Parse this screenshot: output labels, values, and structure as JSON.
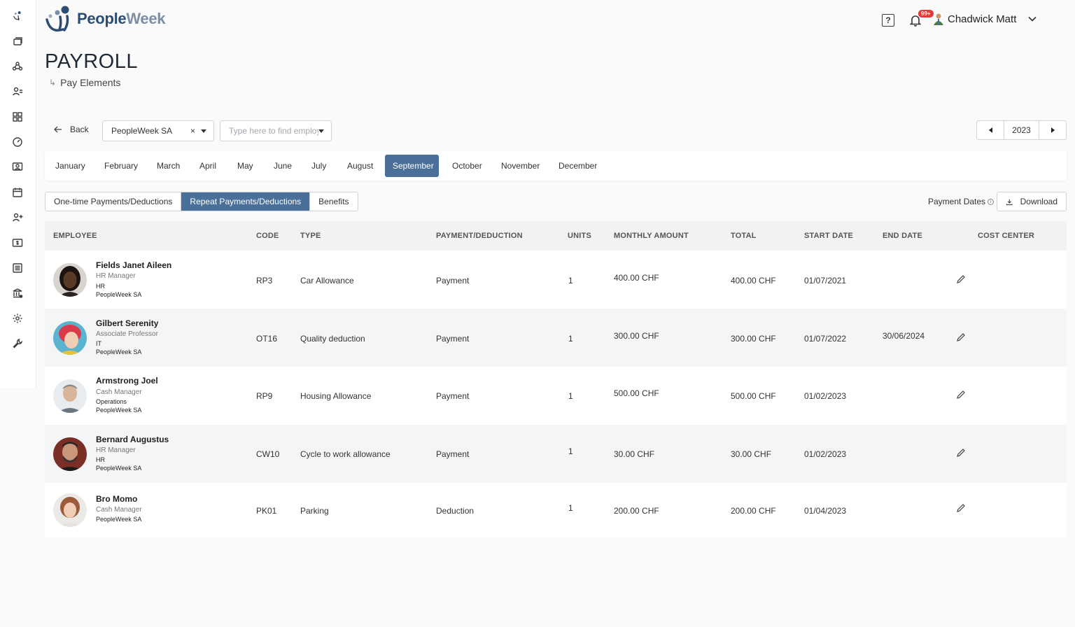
{
  "brand": {
    "name_part1": "People",
    "name_part2": "Week"
  },
  "header": {
    "notification_badge": "99+",
    "user_name": "Chadwick Matt",
    "help_symbol": "?"
  },
  "page": {
    "title": "PAYROLL",
    "breadcrumb": "Pay Elements"
  },
  "filters": {
    "back_label": "Back",
    "company": "PeopleWeek SA",
    "company_clear": "×",
    "employee_placeholder": "Type here to find employee",
    "year": "2023"
  },
  "months": [
    "January",
    "February",
    "March",
    "April",
    "May",
    "June",
    "July",
    "August",
    "September",
    "October",
    "November",
    "December"
  ],
  "active_month": "September",
  "tabs": {
    "one_time": "One-time Payments/Deductions",
    "repeat": "Repeat Payments/Deductions",
    "benefits": "Benefits"
  },
  "actions": {
    "payment_dates": "Payment Dates",
    "download": "Download",
    "info_symbol": "i"
  },
  "table": {
    "headers": {
      "employee": "EMPLOYEE",
      "code": "CODE",
      "type": "TYPE",
      "payment": "PAYMENT/DEDUCTION",
      "units": "UNITS",
      "monthly": "MONTHLY AMOUNT",
      "total": "TOTAL",
      "start": "START DATE",
      "end": "END DATE",
      "cost": "COST CENTER"
    },
    "rows": [
      {
        "name": "Fields Janet Aileen",
        "role": "HR Manager",
        "dept": "HR",
        "company": "PeopleWeek SA",
        "code": "RP3",
        "type": "Car Allowance",
        "payment": "Payment",
        "units": "1",
        "monthly": "400.00 CHF",
        "total": "400.00 CHF",
        "start": "01/07/2021",
        "end": ""
      },
      {
        "name": "Gilbert Serenity",
        "role": "Associate Professor",
        "dept": "IT",
        "company": "PeopleWeek SA",
        "code": "OT16",
        "type": "Quality deduction",
        "payment": "Payment",
        "units": "1",
        "monthly": "300.00 CHF",
        "total": "300.00 CHF",
        "start": "01/07/2022",
        "end": "30/06/2024"
      },
      {
        "name": "Armstrong Joel",
        "role": "Cash Manager",
        "dept": "Operations",
        "company": "PeopleWeek SA",
        "code": "RP9",
        "type": "Housing Allowance",
        "payment": "Payment",
        "units": "1",
        "monthly": "500.00 CHF",
        "total": "500.00 CHF",
        "start": "01/02/2023",
        "end": ""
      },
      {
        "name": "Bernard Augustus",
        "role": "HR Manager",
        "dept": "HR",
        "company": "PeopleWeek SA",
        "code": "CW10",
        "type": "Cycle to work allowance",
        "payment": "Payment",
        "units": "1",
        "monthly": "30.00 CHF",
        "total": "30.00 CHF",
        "start": "01/02/2023",
        "end": ""
      },
      {
        "name": "Bro Momo",
        "role": "Cash Manager",
        "dept": "",
        "company": "PeopleWeek SA",
        "code": "PK01",
        "type": "Parking",
        "payment": "Deduction",
        "units": "1",
        "monthly": "200.00 CHF",
        "total": "200.00 CHF",
        "start": "01/04/2023",
        "end": ""
      }
    ]
  },
  "colors": {
    "accent": "#4a6f98",
    "brand_dark": "#2c4d73",
    "brand_light": "#7c8ea6",
    "badge": "#e53935"
  }
}
